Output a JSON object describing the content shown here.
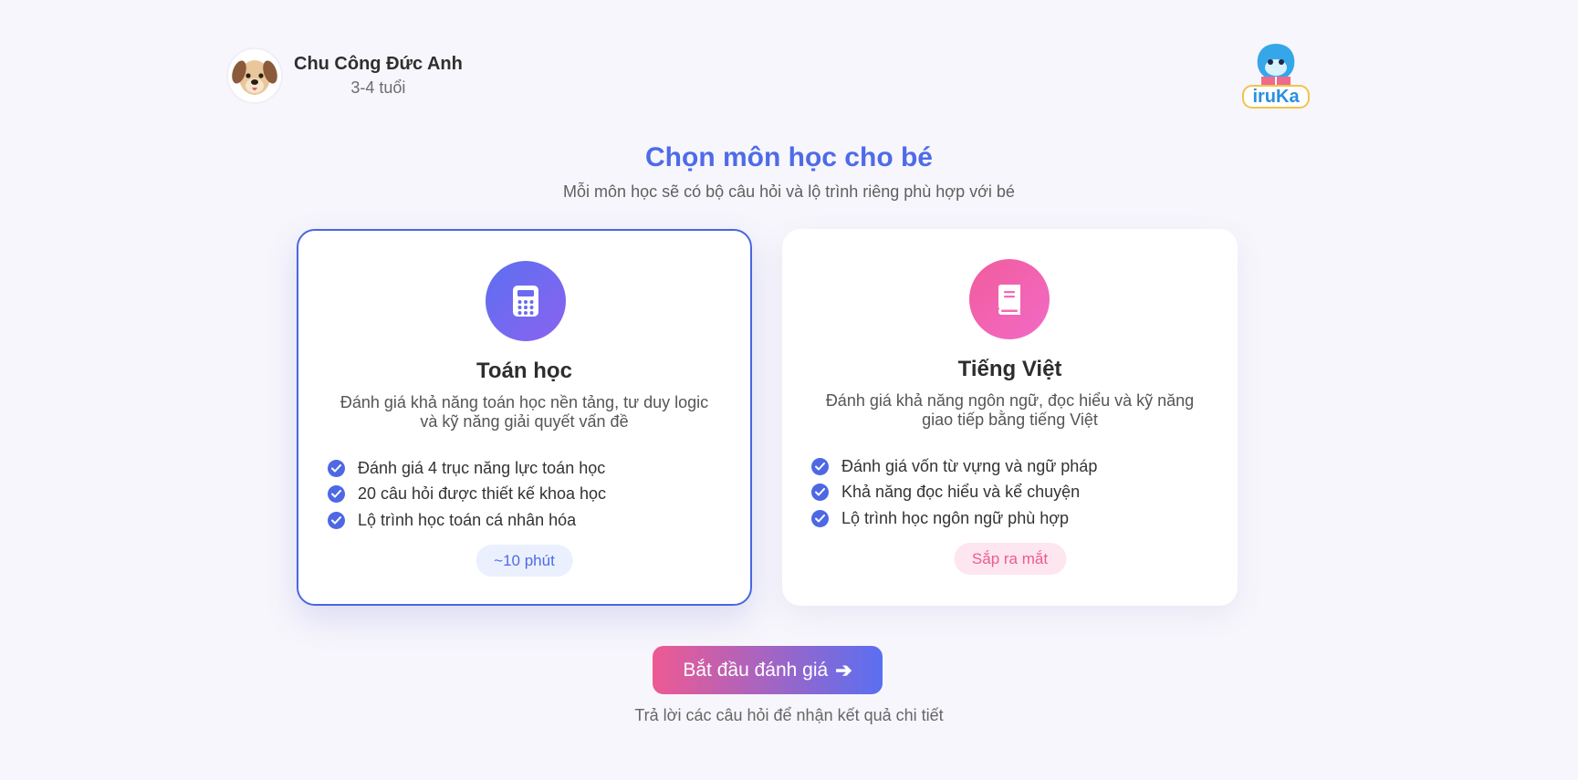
{
  "profile": {
    "name": "Chu Công Đức Anh",
    "age": "3-4 tuổi",
    "avatar_icon": "dog-avatar-icon"
  },
  "logo": {
    "text": "iruKa",
    "icon": "dolphin-logo-icon"
  },
  "heading": {
    "title": "Chọn môn học cho bé",
    "subtitle": "Mỗi môn học sẽ có bộ câu hỏi và lộ trình riêng phù hợp với bé"
  },
  "subjects": [
    {
      "title": "Toán học",
      "icon": "calculator-icon",
      "description": "Đánh giá khả năng toán học nền tảng, tư duy logic và kỹ năng giải quyết vấn đề",
      "features": [
        "Đánh giá 4 trục năng lực toán học",
        "20 câu hỏi được thiết kế khoa học",
        "Lộ trình học toán cá nhân hóa"
      ],
      "badge": "~10 phút",
      "selected": true
    },
    {
      "title": "Tiếng Việt",
      "icon": "book-icon",
      "description": "Đánh giá khả năng ngôn ngữ, đọc hiểu và kỹ năng giao tiếp bằng tiếng Việt",
      "features": [
        "Đánh giá vốn từ vựng và ngữ pháp",
        "Khả năng đọc hiểu và kể chuyện",
        "Lộ trình học ngôn ngữ phù hợp"
      ],
      "badge": "Sắp ra mắt",
      "selected": false
    }
  ],
  "cta": {
    "label": "Bắt đầu đánh giá",
    "icon": "arrow-right-icon",
    "hint": "Trả lời các câu hỏi để nhận kết quả chi tiết"
  },
  "colors": {
    "primary": "#4e6be8",
    "pink": "#ee5a93",
    "background": "#f7f6fc"
  }
}
